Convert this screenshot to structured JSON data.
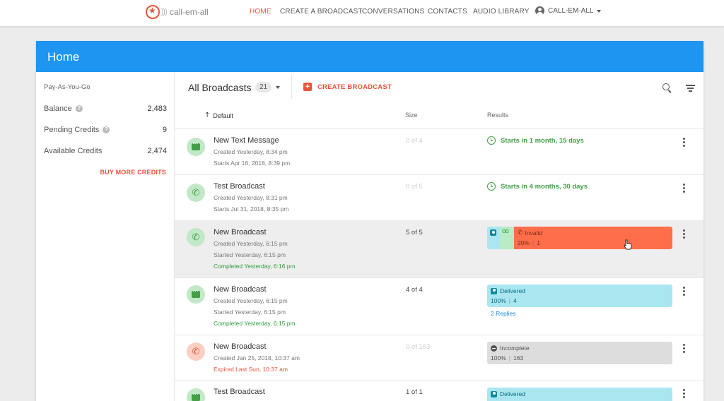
{
  "brand": {
    "name": "call-em-all"
  },
  "nav": {
    "items": [
      "HOME",
      "CREATE A BROADCAST",
      "CONVERSATIONS",
      "CONTACTS",
      "AUDIO LIBRARY"
    ],
    "active": "HOME",
    "account": "CALL-EM-ALL"
  },
  "page": {
    "title": "Home"
  },
  "sidebar": {
    "plan": "Pay-As-You-Go",
    "credits": [
      {
        "label": "Balance",
        "value": "2,483",
        "help": true
      },
      {
        "label": "Pending Credits",
        "value": "9",
        "help": true
      },
      {
        "label": "Available Credits",
        "value": "2,474",
        "help": false
      }
    ],
    "buy_more": "BUY MORE CREDITS"
  },
  "toolbar": {
    "title": "All Broadcasts",
    "count": "21",
    "create_label": "CREATE BROADCAST"
  },
  "columns": {
    "sort": "Default",
    "size": "Size",
    "results": "Results"
  },
  "broadcasts": [
    {
      "type": "text",
      "status": "scheduled",
      "title": "New Text Message",
      "created": "Created Yesterday, 8:34 pm",
      "line2": "Starts Apr 16, 2018, 8:39 pm",
      "line3": "",
      "size": "0 of 4",
      "starts": "Starts in 1 month, 15 days"
    },
    {
      "type": "voice",
      "status": "scheduled",
      "title": "Test Broadcast",
      "created": "Created Yesterday, 8:31 pm",
      "line2": "Starts Jul 31, 2018, 8:35 pm",
      "line3": "",
      "size": "0 of 5",
      "starts": "Starts in 4 months, 30 days"
    },
    {
      "type": "voice",
      "status": "completed",
      "title": "New Broadcast",
      "created": "Created Yesterday, 6:15 pm",
      "line2": "Started Yesterday, 6:15 pm",
      "line3": "Completed Yesterday, 6:16 pm",
      "size": "5 of 5",
      "result": {
        "label": "Invalid",
        "percent": "20%",
        "count": "1"
      }
    },
    {
      "type": "text",
      "status": "completed",
      "title": "New Broadcast",
      "created": "Created Yesterday, 6:15 pm",
      "line2": "Started Yesterday, 6:15 pm",
      "line3": "Completed Yesterday, 6:15 pm",
      "size": "4 of 4",
      "result": {
        "label": "Delivered",
        "percent": "100%",
        "count": "4"
      },
      "replies": "2 Replies"
    },
    {
      "type": "voice",
      "status": "expired",
      "title": "New Broadcast",
      "created": "Created Jan 25, 2018, 10:37 am",
      "line2": "Expired Last Sun, 10:37 am",
      "line3": "",
      "size": "0 of 163",
      "result": {
        "label": "Incomplete",
        "percent": "100%",
        "count": "163"
      }
    },
    {
      "type": "text",
      "status": "completed",
      "title": "Test Broadcast",
      "size": "1 of 1",
      "result": {
        "label": "Delivered"
      }
    }
  ],
  "colors": {
    "accent": "#e8533a",
    "header_blue": "#1e95f0",
    "success_green": "#43a047",
    "delivered_cyan": "#a9e6f0",
    "invalid_orange": "#ff6e4a",
    "incomplete_gray": "#dddddd"
  },
  "icons": {
    "search": "search-icon",
    "filter": "filter-icon",
    "more": "kebab-icon",
    "phone": "phone-icon",
    "message": "message-icon",
    "clock": "clock-icon"
  }
}
